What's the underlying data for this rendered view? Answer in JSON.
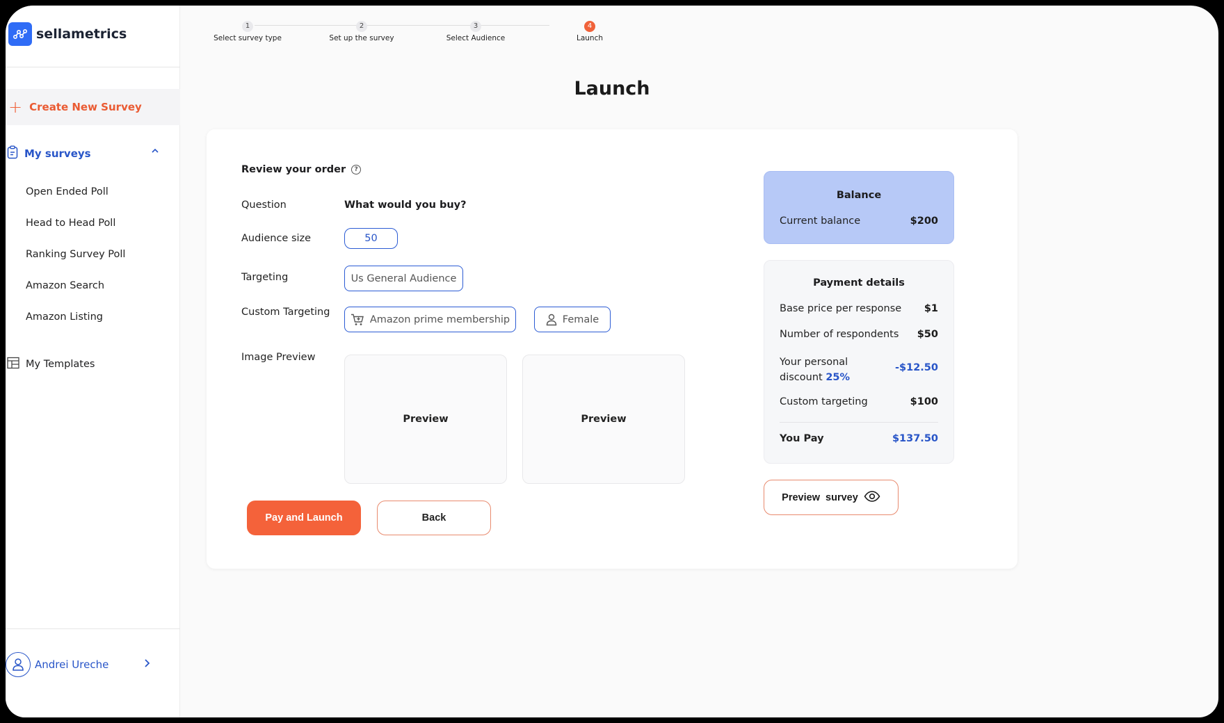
{
  "brand": {
    "name": "sellametrics"
  },
  "sidebar": {
    "create_label": "Create New Survey",
    "my_surveys_label": "My surveys",
    "items": [
      {
        "label": "Open Ended Poll"
      },
      {
        "label": "Head to Head Poll"
      },
      {
        "label": "Ranking Survey Poll"
      },
      {
        "label": "Amazon Search"
      },
      {
        "label": "Amazon Listing"
      }
    ],
    "templates_label": "My Templates",
    "user_name": "Andrei Ureche"
  },
  "stepper": {
    "steps": [
      {
        "number": "1",
        "label": "Select survey type"
      },
      {
        "number": "2",
        "label": "Set up the survey"
      },
      {
        "number": "3",
        "label": "Select Audience"
      },
      {
        "number": "4",
        "label": "Launch"
      }
    ],
    "active_step": 4
  },
  "page": {
    "title": "Launch"
  },
  "review": {
    "title": "Review your order",
    "question_label": "Question",
    "question_value": "What would you buy?",
    "audience_label": "Audience size",
    "audience_value": "50",
    "targeting_label": "Targeting",
    "targeting_value": "Us General Audience",
    "custom_targeting_label": "Custom Targeting",
    "custom_targeting_chips": [
      "Amazon prime membership",
      "Female"
    ],
    "image_preview_label": "Image Preview",
    "preview_labels": [
      "Preview",
      "Preview"
    ]
  },
  "actions": {
    "pay_label": "Pay and Launch",
    "back_label": "Back",
    "preview_survey_label": "Preview  survey"
  },
  "balance": {
    "title": "Balance",
    "current_label": "Current balance",
    "current_value": "$200"
  },
  "payment": {
    "title": "Payment details",
    "base_price_label": "Base price per response",
    "base_price_value": "$1",
    "respondents_label": "Number of respondents",
    "respondents_value": "$50",
    "discount_label_line1": "Your personal",
    "discount_label_line2": "discount",
    "discount_pct": "25%",
    "discount_value": "-$12.50",
    "custom_targeting_label": "Custom targeting",
    "custom_targeting_value": "$100",
    "you_pay_label": "You Pay",
    "you_pay_value": "$137.50"
  },
  "colors": {
    "accent_orange": "#f4623a",
    "accent_blue": "#2855c8",
    "balance_bg": "#b7c9f7"
  }
}
